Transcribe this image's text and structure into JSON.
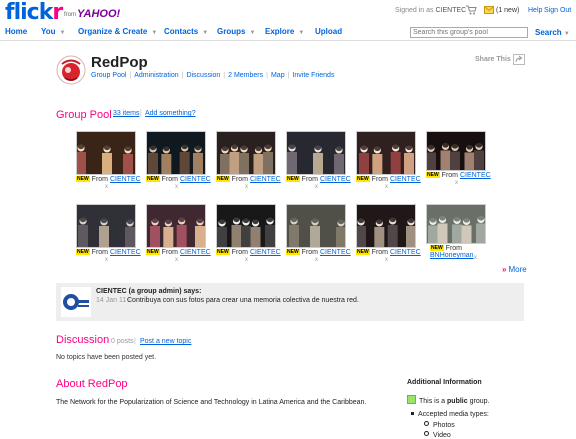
{
  "header": {
    "logo_part1": "flick",
    "logo_part2": "r",
    "from_text": "from",
    "yahoo_text": "YAHOO!",
    "signed_in_prefix": "Signed in as",
    "signed_in_user": "CIENTEC",
    "mail_new": "(1 new)",
    "help": "Help",
    "sign_out": "Sign Out"
  },
  "nav": {
    "items": [
      "Home",
      "You",
      "Organize & Create",
      "Contacts",
      "Groups",
      "Explore",
      "Upload"
    ],
    "search_placeholder": "Search this group's pool",
    "search_button": "Search"
  },
  "group": {
    "title": "RedPop",
    "tabs": [
      "Group Pool",
      "Administration",
      "Discussion",
      "2 Members",
      "Map",
      "Invite Friends"
    ],
    "share_label": "Share This"
  },
  "pool": {
    "title": "Group Pool",
    "count": "33 items",
    "add_link": "Add something?",
    "new_badge": "NEW",
    "from_label": "From",
    "x_mark": "x",
    "photos": [
      {
        "owner": "CIENTEC"
      },
      {
        "owner": "CIENTEC"
      },
      {
        "owner": "CIENTEC"
      },
      {
        "owner": "CIENTEC"
      },
      {
        "owner": "CIENTEC"
      },
      {
        "owner": "CIENTEC"
      },
      {
        "owner": "CIENTEC"
      },
      {
        "owner": "CIENTEC"
      },
      {
        "owner": "CIENTEC"
      },
      {
        "owner": "CIENTEC"
      },
      {
        "owner": "CIENTEC"
      },
      {
        "owner": "BNHoneyman"
      }
    ],
    "more": "More"
  },
  "admin_note": {
    "author": "CIENTEC (a group admin) says:",
    "date": "14 Jan 11 -",
    "message": "Contribuya con sus fotos para crear una memoria colectiva de nuestra red."
  },
  "discussion": {
    "title": "Discussion",
    "count": "0 posts",
    "new_topic": "Post a new topic",
    "empty": "No topics have been posted yet."
  },
  "about": {
    "title": "About RedPop",
    "description": "The Network for the Popularization of Science and Technology in Latina America and the Caribbean."
  },
  "additional": {
    "title": "Additional Information",
    "public_prefix": "This is a",
    "public_word": "public",
    "public_suffix": "group.",
    "media_label": "Accepted media types:",
    "media_types": [
      "Photos",
      "Video"
    ]
  },
  "colors": {
    "flickr_blue": "#0063dc",
    "flickr_pink": "#ff0084",
    "new_badge": "#ffe500"
  }
}
